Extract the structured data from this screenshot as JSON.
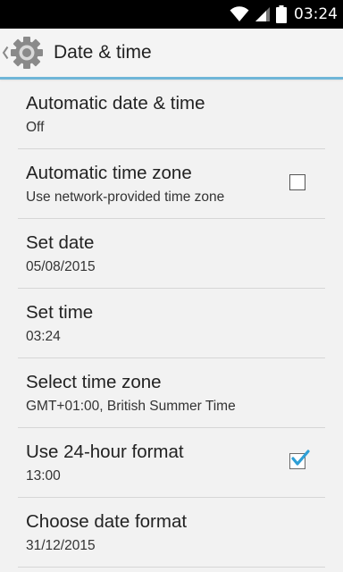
{
  "status_bar": {
    "time": "03:24",
    "icons": [
      "wifi-icon",
      "signal-icon",
      "battery-icon"
    ]
  },
  "action_bar": {
    "title": "Date & time",
    "icons": [
      "back-chevron-icon",
      "settings-gear-icon"
    ],
    "accent_color": "#6fb6d8"
  },
  "settings": [
    {
      "title": "Automatic date & time",
      "summary": "Off",
      "control": "none"
    },
    {
      "title": "Automatic time zone",
      "summary": "Use network-provided time zone",
      "control": "checkbox",
      "checked": false
    },
    {
      "title": "Set date",
      "summary": "05/08/2015",
      "control": "none"
    },
    {
      "title": "Set time",
      "summary": "03:24",
      "control": "none"
    },
    {
      "title": "Select time zone",
      "summary": "GMT+01:00, British Summer Time",
      "control": "none"
    },
    {
      "title": "Use 24-hour format",
      "summary": "13:00",
      "control": "checkbox",
      "checked": true
    },
    {
      "title": "Choose date format",
      "summary": "31/12/2015",
      "control": "none"
    }
  ],
  "colors": {
    "checkmark": "#2e9fd6",
    "background": "#f2f2f2",
    "divider": "#d6d6d6"
  }
}
